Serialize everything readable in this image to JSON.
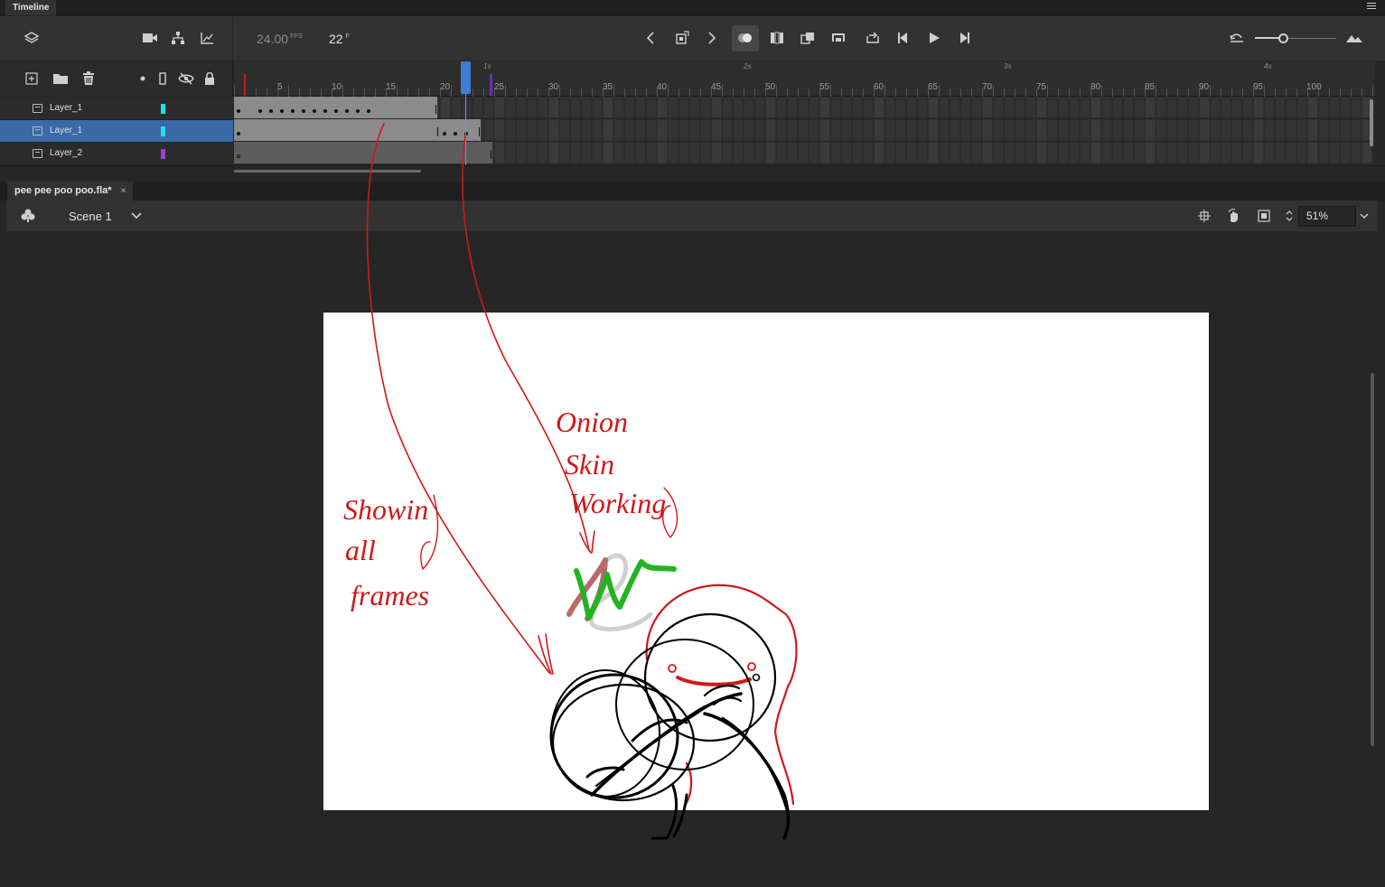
{
  "panel": {
    "title": "Timeline"
  },
  "toolbar": {
    "fps_value": "24.00",
    "fps_unit": "FPS",
    "current_frame": "22",
    "frame_unit": "F",
    "zoom_level": 0.35,
    "icons": [
      "layers-icon",
      "camera-icon",
      "hierarchy-icon",
      "graph-icon",
      "chevron-left-icon",
      "loop-icon",
      "chevron-right-icon",
      "onion-skin-icon",
      "edit-multiple-frames-icon",
      "insert-keyframe-icon",
      "insert-blank-keyframe-icon",
      "loop-playback-icon",
      "step-back-icon",
      "play-icon",
      "step-forward-icon",
      "undo-icon",
      "mountain-icon"
    ]
  },
  "layers_toolbar": {
    "icons": [
      "add-layer-icon",
      "folder-icon",
      "trash-icon",
      "dot-icon",
      "outline-icon",
      "eye-slash-icon",
      "lock-icon"
    ]
  },
  "layers": [
    {
      "name": "Layer_1",
      "color": "#1ee3ef",
      "selected": false
    },
    {
      "name": "Layer_1",
      "color": "#1ee3ef",
      "selected": true
    },
    {
      "name": "Layer_2",
      "color": "#a23cd6",
      "selected": false
    }
  ],
  "ruler": {
    "frame_ticks": [
      "5",
      "10",
      "15",
      "20",
      "25",
      "30",
      "35",
      "40",
      "45",
      "50",
      "55",
      "60",
      "65",
      "70",
      "75",
      "80",
      "85",
      "90",
      "95",
      "100"
    ],
    "seconds": [
      "1s",
      "2s",
      "3s",
      "4s"
    ]
  },
  "document": {
    "tab_title": "pee pee poo poo.fla*",
    "close": "×"
  },
  "editbar": {
    "scene": "Scene 1",
    "zoom": "51%"
  },
  "annotations": {
    "left_note": "Showin all frames",
    "right_note": "Onion Skin Working"
  },
  "colors": {
    "accent": "#3f7dd2",
    "selection": "#3a6aa8",
    "annotation": "#d01818"
  }
}
